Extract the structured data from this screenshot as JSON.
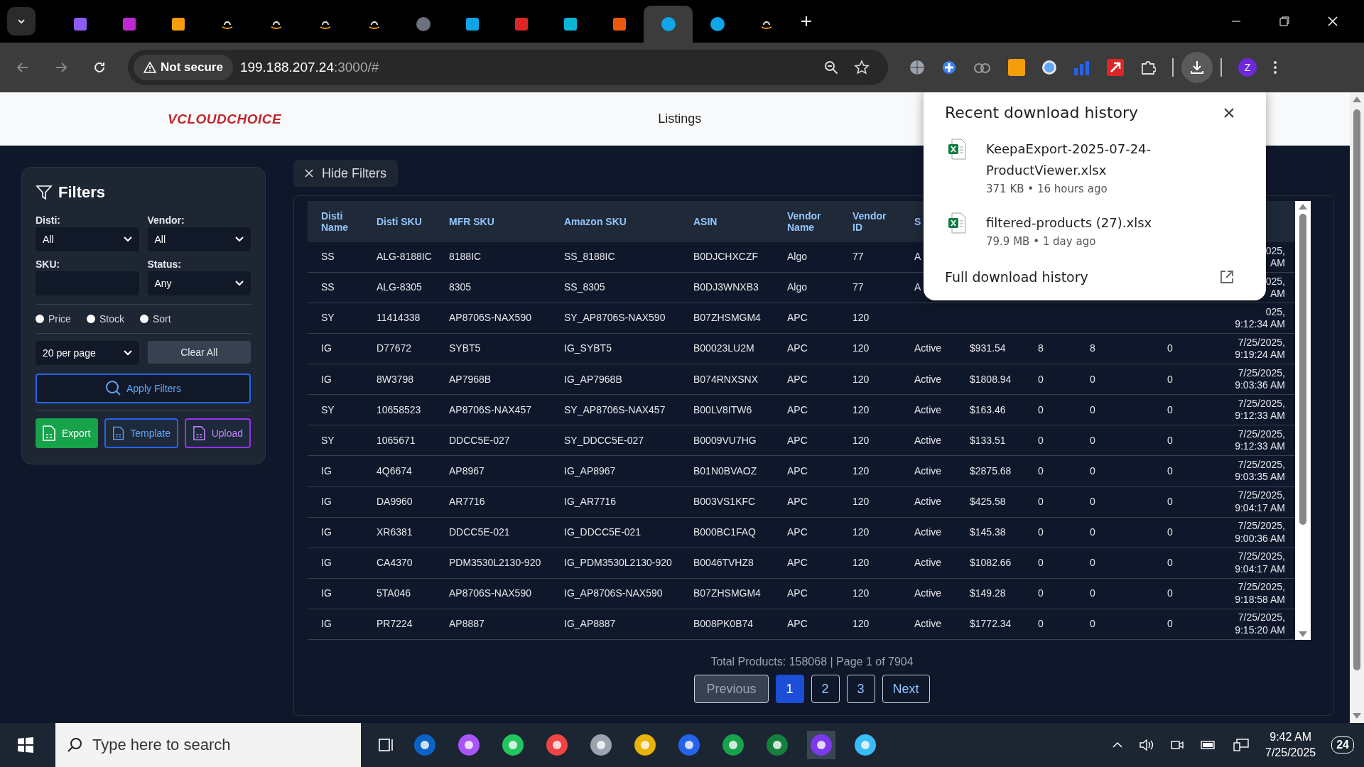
{
  "browser": {
    "tabs": [
      {
        "kind": "cube",
        "selected": false
      },
      {
        "kind": "heart",
        "selected": false
      },
      {
        "kind": "box",
        "selected": false
      },
      {
        "kind": "amazon",
        "selected": false
      },
      {
        "kind": "amazon",
        "selected": false
      },
      {
        "kind": "amazon",
        "selected": false
      },
      {
        "kind": "amazon",
        "selected": false
      },
      {
        "kind": "globe",
        "selected": false
      },
      {
        "kind": "square",
        "selected": false
      },
      {
        "kind": "red",
        "selected": false
      },
      {
        "kind": "ec",
        "selected": false
      },
      {
        "kind": "layers",
        "selected": false
      },
      {
        "kind": "dollar",
        "selected": true
      },
      {
        "kind": "dollar",
        "selected": false
      },
      {
        "kind": "amazon",
        "selected": false
      }
    ],
    "security": "Not secure",
    "host": "199.188.207.24",
    "path": ":3000/#",
    "profile": "Z"
  },
  "header": {
    "logo": "VCLOUDCHOICE",
    "nav": "Listings"
  },
  "filters": {
    "title": "Filters",
    "selects": [
      {
        "label": "Disti:",
        "value": "All"
      },
      {
        "label": "Vendor:",
        "value": "All"
      }
    ],
    "sku": {
      "label": "SKU:"
    },
    "status": {
      "label": "Status:",
      "value": "Any"
    },
    "radios": [
      {
        "label": "Price",
        "checked": false
      },
      {
        "label": "Stock",
        "checked": false
      },
      {
        "label": "Sort",
        "checked": false
      }
    ],
    "per_page": "20 per page",
    "clear": "Clear All",
    "apply": "Apply Filters",
    "actions": [
      {
        "label": "Export",
        "kind": "export"
      },
      {
        "label": "Template",
        "kind": "template"
      },
      {
        "label": "Upload",
        "kind": "upload"
      }
    ]
  },
  "hide_filters": "Hide Filters",
  "table": {
    "columns": [
      "Disti Name",
      "Disti SKU",
      "MFR SKU",
      "Amazon SKU",
      "ASIN",
      "Vendor Name",
      "Vendor ID",
      "S"
    ],
    "rows": [
      [
        "SS",
        "ALG-8188IC",
        "8188IC",
        "SS_8188IC",
        "B0DJCHXCZF",
        "Algo",
        "77",
        "A",
        null,
        null,
        null,
        null,
        "025,\nAM"
      ],
      [
        "SS",
        "ALG-8305",
        "8305",
        "SS_8305",
        "B0DJ3WNXB3",
        "Algo",
        "77",
        "A",
        null,
        null,
        null,
        null,
        "025,\nAM"
      ],
      [
        "SY",
        "11414338",
        "AP8706S-NAX590",
        "SY_AP8706S-NAX590",
        "B07ZHSMGM4",
        "APC",
        "120",
        null,
        null,
        null,
        null,
        null,
        "025,\n9:12:34 AM"
      ],
      [
        "IG",
        "D77672",
        "SYBT5",
        "IG_SYBT5",
        "B00023LU2M",
        "APC",
        "120",
        "Active",
        "$931.54",
        "8",
        "8",
        "0",
        "7/25/2025,\n9:19:24 AM"
      ],
      [
        "IG",
        "8W3798",
        "AP7968B",
        "IG_AP7968B",
        "B074RNXSNX",
        "APC",
        "120",
        "Active",
        "$1808.94",
        "0",
        "0",
        "0",
        "7/25/2025,\n9:03:36 AM"
      ],
      [
        "SY",
        "10658523",
        "AP8706S-NAX457",
        "SY_AP8706S-NAX457",
        "B00LV8ITW6",
        "APC",
        "120",
        "Active",
        "$163.46",
        "0",
        "0",
        "0",
        "7/25/2025,\n9:12:33 AM"
      ],
      [
        "SY",
        "1065671",
        "DDCC5E-027",
        "SY_DDCC5E-027",
        "B0009VU7HG",
        "APC",
        "120",
        "Active",
        "$133.51",
        "0",
        "0",
        "0",
        "7/25/2025,\n9:12:33 AM"
      ],
      [
        "IG",
        "4Q6674",
        "AP8967",
        "IG_AP8967",
        "B01N0BVAOZ",
        "APC",
        "120",
        "Active",
        "$2875.68",
        "0",
        "0",
        "0",
        "7/25/2025,\n9:03:35 AM"
      ],
      [
        "IG",
        "DA9960",
        "AR7716",
        "IG_AR7716",
        "B003VS1KFC",
        "APC",
        "120",
        "Active",
        "$425.58",
        "0",
        "0",
        "0",
        "7/25/2025,\n9:04:17 AM"
      ],
      [
        "IG",
        "XR6381",
        "DDCC5E-021",
        "IG_DDCC5E-021",
        "B000BC1FAQ",
        "APC",
        "120",
        "Active",
        "$145.38",
        "0",
        "0",
        "0",
        "7/25/2025,\n9:00:36 AM"
      ],
      [
        "IG",
        "CA4370",
        "PDM3530L2130-920",
        "IG_PDM3530L2130-920",
        "B0046TVHZ8",
        "APC",
        "120",
        "Active",
        "$1082.66",
        "0",
        "0",
        "0",
        "7/25/2025,\n9:04:17 AM"
      ],
      [
        "IG",
        "5TA046",
        "AP8706S-NAX590",
        "IG_AP8706S-NAX590",
        "B07ZHSMGM4",
        "APC",
        "120",
        "Active",
        "$149.28",
        "0",
        "0",
        "0",
        "7/25/2025,\n9:18:58 AM"
      ],
      [
        "IG",
        "PR7224",
        "AP8887",
        "IG_AP8887",
        "B008PK0B74",
        "APC",
        "120",
        "Active",
        "$1772.34",
        "0",
        "0",
        "0",
        "7/25/2025,\n9:15:20 AM"
      ]
    ]
  },
  "summary": "Total Products: 158068 | Page 1 of 7904",
  "pagination": [
    {
      "label": "Previous",
      "kind": "nav",
      "selected": false,
      "disabled": true
    },
    {
      "label": "1",
      "kind": "page",
      "selected": true,
      "disabled": false
    },
    {
      "label": "2",
      "kind": "page",
      "selected": false,
      "disabled": false
    },
    {
      "label": "3",
      "kind": "page",
      "selected": false,
      "disabled": false
    },
    {
      "label": "Next",
      "kind": "nav",
      "selected": false,
      "disabled": false
    }
  ],
  "downloads": {
    "title": "Recent download history",
    "items": [
      {
        "name": "KeepaExport-2025-07-24-ProductViewer.xlsx",
        "meta": "371 KB • 16 hours ago"
      },
      {
        "name": "filtered-products (27).xlsx",
        "meta": "79.9 MB • 1 day ago"
      }
    ],
    "footer": "Full download history"
  },
  "taskbar": {
    "search_placeholder": "Type here to search",
    "time": "9:42 AM",
    "date": "7/25/2025",
    "notifications": "24"
  }
}
